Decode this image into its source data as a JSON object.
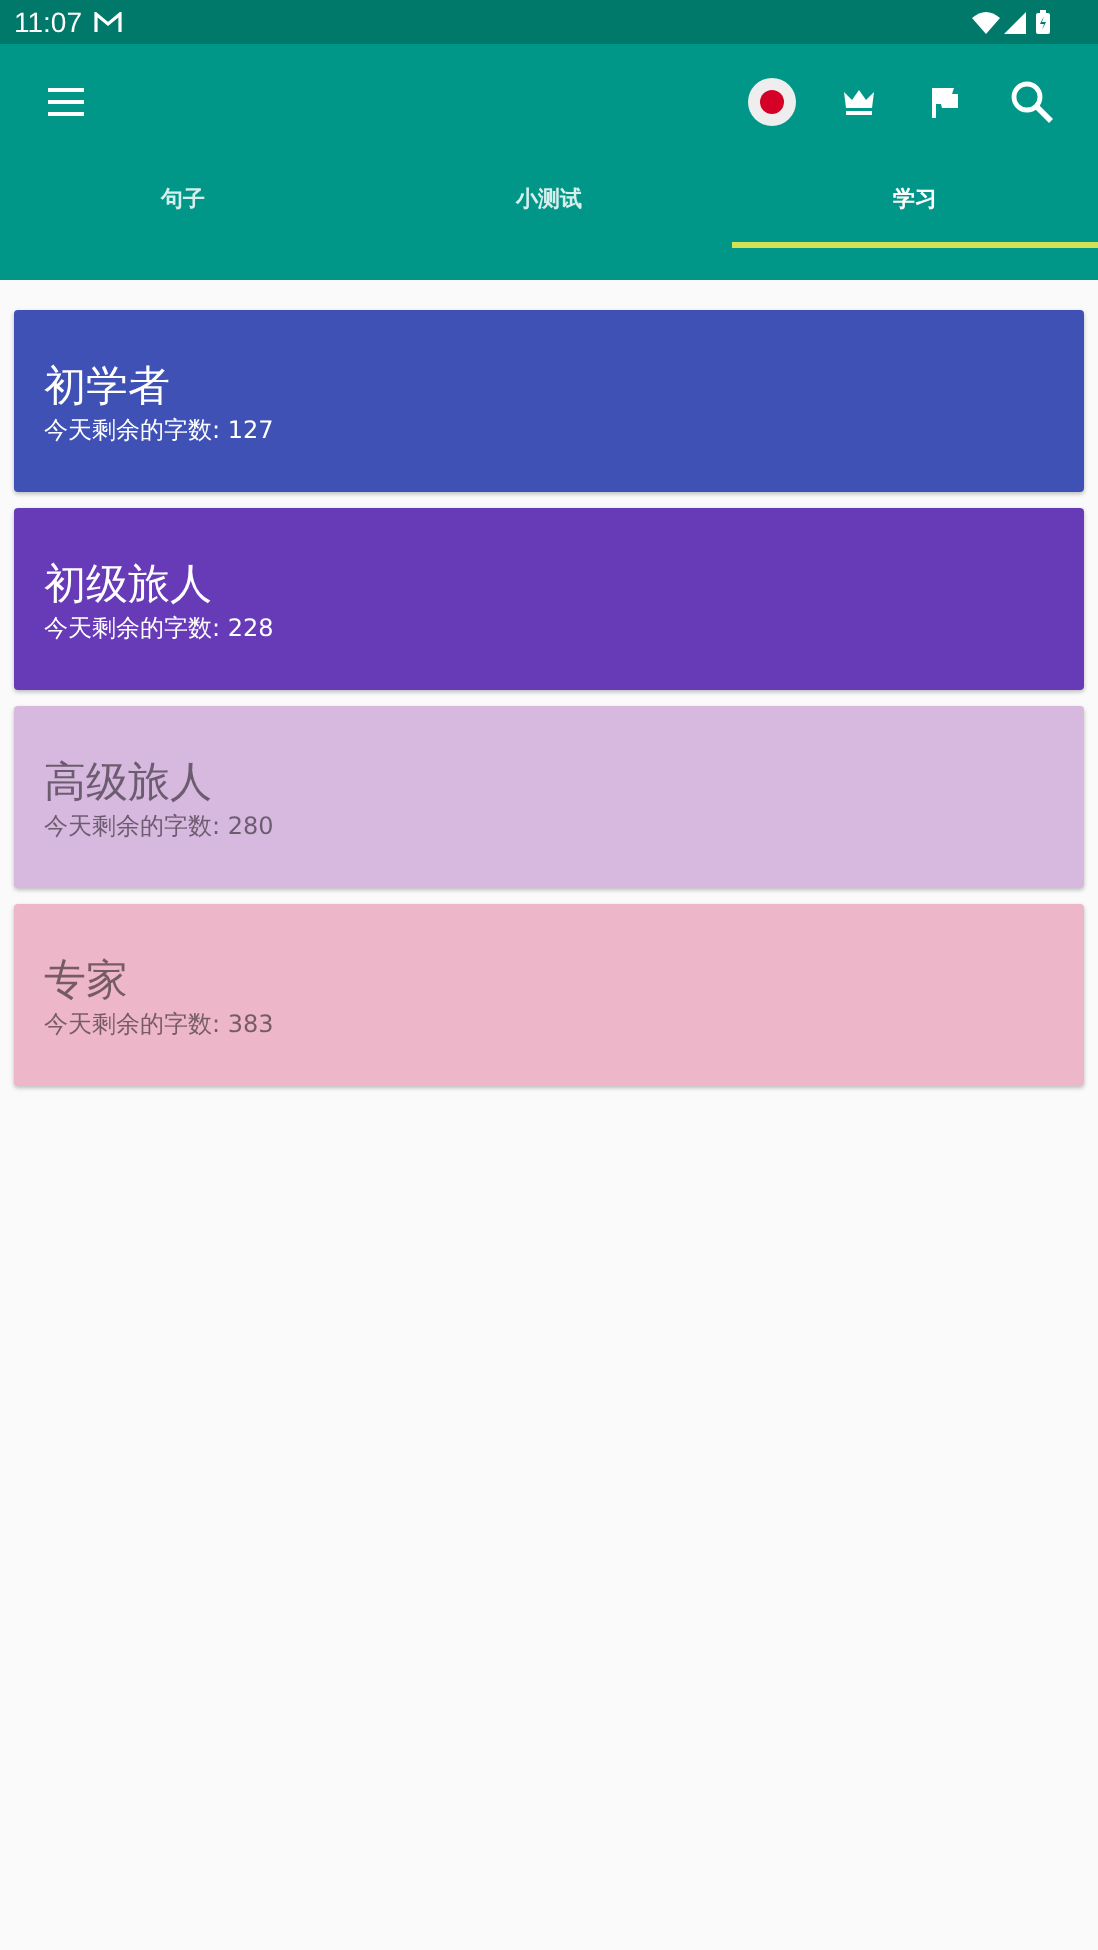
{
  "status_bar": {
    "time": "11:07"
  },
  "tabs": [
    {
      "label": "句子",
      "selected": false
    },
    {
      "label": "小测试",
      "selected": false
    },
    {
      "label": "学习",
      "selected": true
    }
  ],
  "levels": [
    {
      "title": "初学者",
      "subtitle": "今天剩余的字数: 127",
      "color": "#3f51b5",
      "disabled": false
    },
    {
      "title": "初级旅人",
      "subtitle": "今天剩余的字数: 228",
      "color": "#673ab7",
      "disabled": false
    },
    {
      "title": "高级旅人",
      "subtitle": "今天剩余的字数: 280",
      "color": "#d7b8df",
      "disabled": true
    },
    {
      "title": "专家",
      "subtitle": "今天剩余的字数: 383",
      "color": "#edb7c9",
      "disabled": true
    }
  ]
}
